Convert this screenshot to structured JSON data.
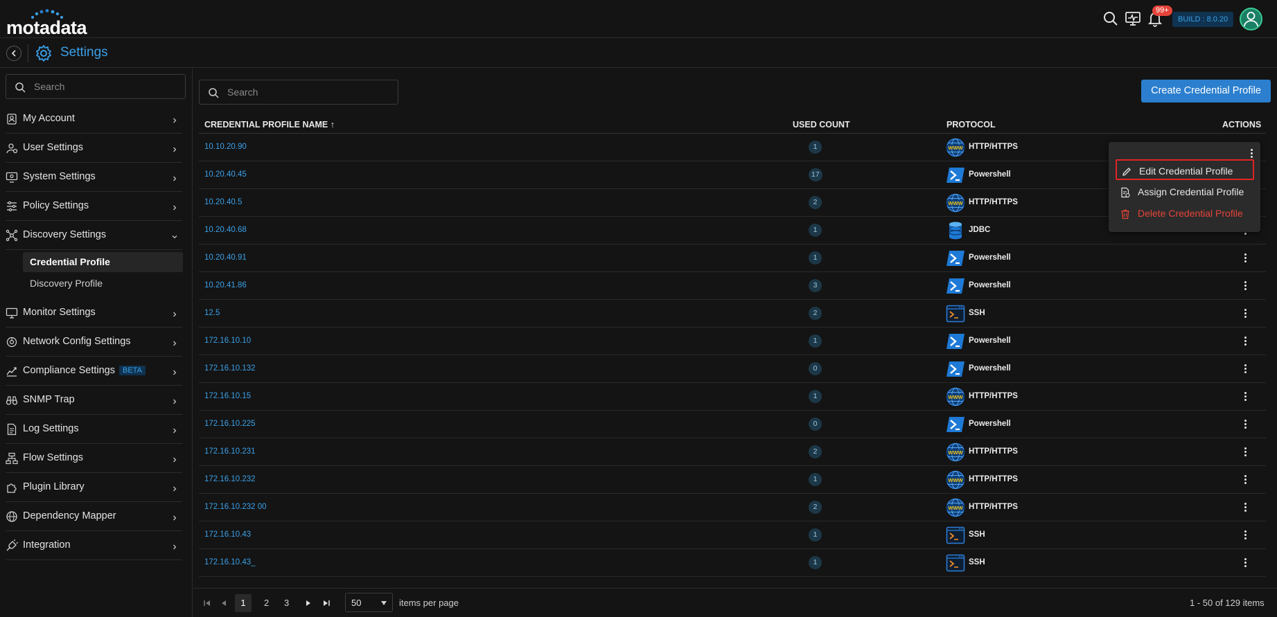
{
  "topbar": {
    "logo": "motadata",
    "notification_badge": "99+",
    "build": "BUILD : 8.0.20"
  },
  "header": {
    "title": "Settings"
  },
  "sidebar": {
    "search_placeholder": "Search",
    "items": [
      {
        "label": "My Account",
        "icon": "user-card-icon"
      },
      {
        "label": "User Settings",
        "icon": "user-gear-icon"
      },
      {
        "label": "System Settings",
        "icon": "monitor-gear-icon"
      },
      {
        "label": "Policy Settings",
        "icon": "sliders-icon"
      },
      {
        "label": "Discovery Settings",
        "icon": "network-nodes-icon",
        "expanded": true
      },
      {
        "label": "Monitor Settings",
        "icon": "monitor-icon"
      },
      {
        "label": "Network Config Settings",
        "icon": "network-config-icon"
      },
      {
        "label": "Compliance Settings",
        "icon": "compliance-icon",
        "badge": "BETA"
      },
      {
        "label": "SNMP Trap",
        "icon": "binoculars-icon"
      },
      {
        "label": "Log Settings",
        "icon": "document-icon"
      },
      {
        "label": "Flow Settings",
        "icon": "flow-icon"
      },
      {
        "label": "Plugin Library",
        "icon": "puzzle-icon"
      },
      {
        "label": "Dependency Mapper",
        "icon": "globe-icon"
      },
      {
        "label": "Integration",
        "icon": "plug-icon"
      }
    ],
    "subitems": [
      {
        "label": "Credential Profile",
        "active": true
      },
      {
        "label": "Discovery Profile",
        "active": false
      }
    ]
  },
  "main": {
    "search_placeholder": "Search",
    "create_button": "Create Credential Profile",
    "columns": {
      "name": "CREDENTIAL PROFILE NAME ↑",
      "used_count": "USED COUNT",
      "protocol": "PROTOCOL",
      "actions": "ACTIONS"
    },
    "rows": [
      {
        "name": "10.10.20.90",
        "count": "1",
        "protocol": "HTTP/HTTPS",
        "icon": "www-icon"
      },
      {
        "name": "10.20.40.45",
        "count": "17",
        "protocol": "Powershell",
        "icon": "powershell-icon"
      },
      {
        "name": "10.20.40.5",
        "count": "2",
        "protocol": "HTTP/HTTPS",
        "icon": "www-icon"
      },
      {
        "name": "10.20.40.68",
        "count": "1",
        "protocol": "JDBC",
        "icon": "database-icon"
      },
      {
        "name": "10.20.40.91",
        "count": "1",
        "protocol": "Powershell",
        "icon": "powershell-icon"
      },
      {
        "name": "10.20.41.86",
        "count": "3",
        "protocol": "Powershell",
        "icon": "powershell-icon"
      },
      {
        "name": "12.5",
        "count": "2",
        "protocol": "SSH",
        "icon": "terminal-icon"
      },
      {
        "name": "172.16.10.10",
        "count": "1",
        "protocol": "Powershell",
        "icon": "powershell-icon"
      },
      {
        "name": "172.16.10.132",
        "count": "0",
        "protocol": "Powershell",
        "icon": "powershell-icon"
      },
      {
        "name": "172.16.10.15",
        "count": "1",
        "protocol": "HTTP/HTTPS",
        "icon": "www-icon"
      },
      {
        "name": "172.16.10.225",
        "count": "0",
        "protocol": "Powershell",
        "icon": "powershell-icon"
      },
      {
        "name": "172.16.10.231",
        "count": "2",
        "protocol": "HTTP/HTTPS",
        "icon": "www-icon"
      },
      {
        "name": "172.16.10.232",
        "count": "1",
        "protocol": "HTTP/HTTPS",
        "icon": "www-icon"
      },
      {
        "name": "172.16.10.232 00",
        "count": "2",
        "protocol": "HTTP/HTTPS",
        "icon": "www-icon"
      },
      {
        "name": "172.16.10.43",
        "count": "1",
        "protocol": "SSH",
        "icon": "terminal-icon"
      },
      {
        "name": "172.16.10.43_",
        "count": "1",
        "protocol": "SSH",
        "icon": "terminal-icon"
      }
    ]
  },
  "action_menu": {
    "edit": "Edit Credential Profile",
    "assign": "Assign Credential Profile",
    "delete": "Delete Credential Profile"
  },
  "pager": {
    "pages": [
      "1",
      "2",
      "3"
    ],
    "per_page": "50",
    "per_page_label": "items per page",
    "summary": "1 - 50 of 129 items"
  },
  "colors": {
    "accent": "#3aa0e8",
    "button": "#2b7fce",
    "danger": "#e5443a",
    "background": "#141414"
  }
}
